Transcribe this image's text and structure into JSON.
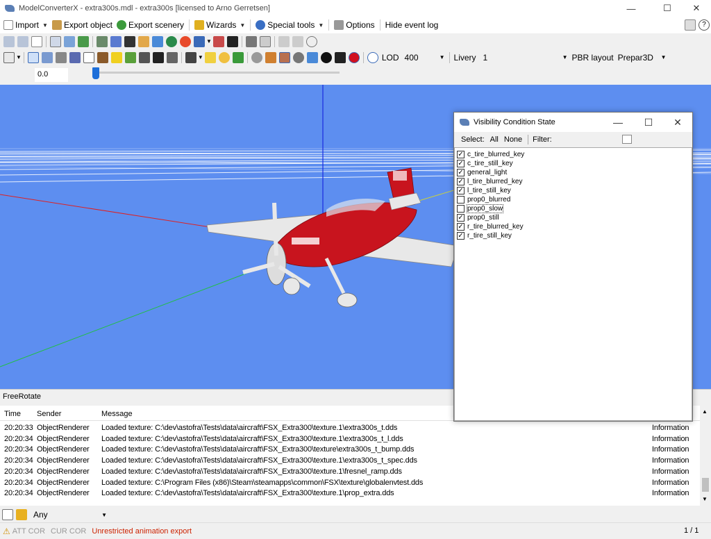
{
  "window": {
    "title": "ModelConverterX - extra300s.mdl - extra300s [licensed to Arno Gerretsen]"
  },
  "menu": {
    "import": "Import",
    "export_object": "Export object",
    "export_scenery": "Export scenery",
    "wizards": "Wizards",
    "special_tools": "Special tools",
    "options": "Options",
    "hide_event_log": "Hide event log"
  },
  "toolbar3": {
    "lod_label": "LOD",
    "lod_value": "400",
    "livery_label": "Livery",
    "livery_value": "1",
    "pbr_label": "PBR layout",
    "pbr_value": "Prepar3D"
  },
  "slider": {
    "value": "0.0",
    "position": 0
  },
  "panel_title": "FreeRotate",
  "log": {
    "headers": {
      "time": "Time",
      "sender": "Sender",
      "message": "Message"
    },
    "rows": [
      {
        "time": "20:20:33",
        "sender": "ObjectRenderer",
        "message": "Loaded texture: C:\\dev\\astofra\\Tests\\data\\aircraft\\FSX_Extra300\\texture.1\\extra300s_t.dds",
        "level": "Information"
      },
      {
        "time": "20:20:34",
        "sender": "ObjectRenderer",
        "message": "Loaded texture: C:\\dev\\astofra\\Tests\\data\\aircraft\\FSX_Extra300\\texture.1\\extra300s_t_l.dds",
        "level": "Information"
      },
      {
        "time": "20:20:34",
        "sender": "ObjectRenderer",
        "message": "Loaded texture: C:\\dev\\astofra\\Tests\\data\\aircraft\\FSX_Extra300\\texture\\extra300s_t_bump.dds",
        "level": "Information"
      },
      {
        "time": "20:20:34",
        "sender": "ObjectRenderer",
        "message": "Loaded texture: C:\\dev\\astofra\\Tests\\data\\aircraft\\FSX_Extra300\\texture.1\\extra300s_t_spec.dds",
        "level": "Information"
      },
      {
        "time": "20:20:34",
        "sender": "ObjectRenderer",
        "message": "Loaded texture: C:\\dev\\astofra\\Tests\\data\\aircraft\\FSX_Extra300\\texture.1\\fresnel_ramp.dds",
        "level": "Information"
      },
      {
        "time": "20:20:34",
        "sender": "ObjectRenderer",
        "message": "Loaded texture: C:\\Program Files (x86)\\Steam\\steamapps\\common\\FSX\\texture\\globalenvtest.dds",
        "level": "Information"
      },
      {
        "time": "20:20:34",
        "sender": "ObjectRenderer",
        "message": "Loaded texture: C:\\dev\\astofra\\Tests\\data\\aircraft\\FSX_Extra300\\texture.1\\prop_extra.dds",
        "level": "Information"
      }
    ]
  },
  "filter": {
    "value": "Any"
  },
  "status": {
    "att_cor": "ATT COR",
    "cur_cor": "CUR COR",
    "warning": "Unrestricted animation export",
    "page": "1 / 1"
  },
  "dialog": {
    "title": "Visibility Condition State",
    "select_label": "Select:",
    "all": "All",
    "none": "None",
    "filter_label": "Filter:",
    "items": [
      {
        "label": "c_tire_blurred_key",
        "checked": true
      },
      {
        "label": "c_tire_still_key",
        "checked": true
      },
      {
        "label": "general_light",
        "checked": true
      },
      {
        "label": "l_tire_blurred_key",
        "checked": true
      },
      {
        "label": "l_tire_still_key",
        "checked": true
      },
      {
        "label": "prop0_blurred",
        "checked": false
      },
      {
        "label": "prop0_slow",
        "checked": false
      },
      {
        "label": "prop0_still",
        "checked": true
      },
      {
        "label": "r_tire_blurred_key",
        "checked": true
      },
      {
        "label": "r_tire_still_key",
        "checked": true
      }
    ]
  },
  "colors": {
    "viewport_sky": "#5d8ef0",
    "aircraft_red": "#c8141e",
    "warning": "#cc2200"
  },
  "icons": {
    "import": "import-icon",
    "export_object": "house-icon",
    "export_scenery": "globe-icon",
    "wizards": "wand-icon",
    "special_tools": "gear-icon",
    "options": "wrench-icon"
  }
}
